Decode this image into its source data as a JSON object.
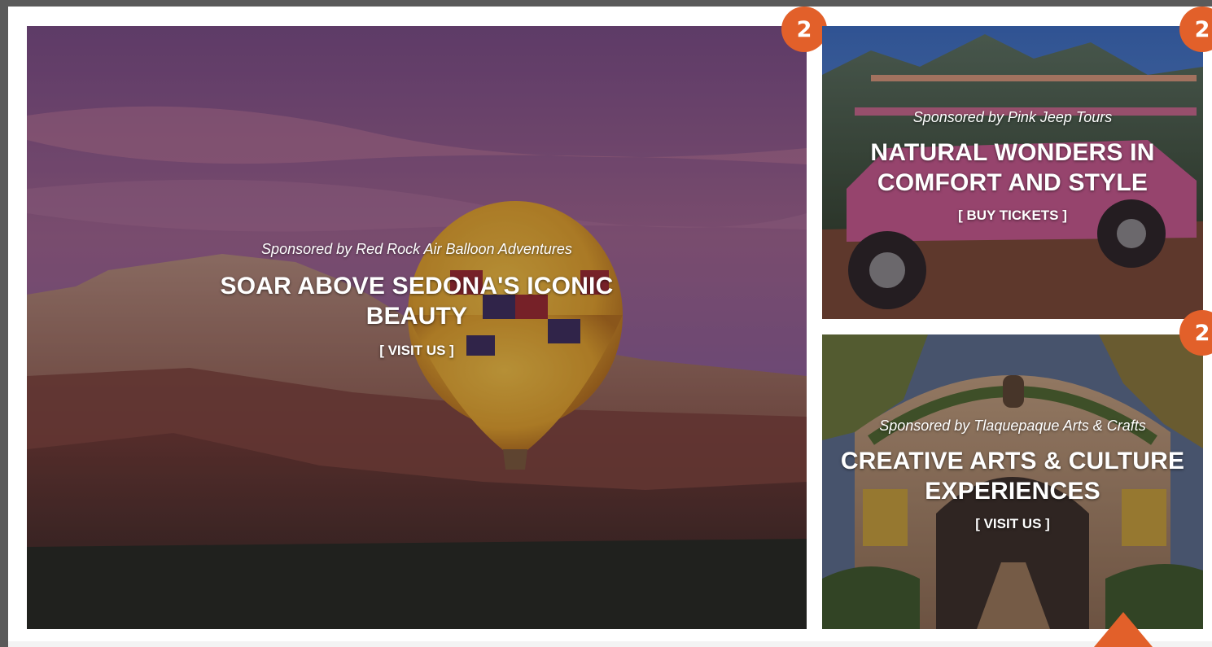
{
  "cards": [
    {
      "sponsor": "Sponsored by Red Rock Air Balloon Adventures",
      "headline_line1": "SOAR ABOVE SEDONA'S ICONIC",
      "headline_line2": "BEAUTY",
      "cta": "[ VISIT US ]",
      "badge": "2",
      "image": "hot-air-balloon-over-red-rocks"
    },
    {
      "sponsor": "Sponsored by Pink Jeep Tours",
      "headline_line1": "NATURAL WONDERS IN",
      "headline_line2": "COMFORT AND STYLE",
      "cta": "[ BUY TICKETS ]",
      "badge": "2",
      "image": "pink-jeep-tour"
    },
    {
      "sponsor": "Sponsored by Tlaquepaque Arts & Crafts",
      "headline_line1": "CREATIVE ARTS & CULTURE",
      "headline_line2": "EXPERIENCES",
      "cta": "[ VISIT US ]",
      "badge": "2",
      "image": "tlaquepaque-archway"
    }
  ],
  "colors": {
    "badge": "#e2602a",
    "accent_arrow": "#e2602a",
    "background": "#ffffff"
  },
  "icons": {
    "scroll_arrow": "triangle-up-icon"
  }
}
